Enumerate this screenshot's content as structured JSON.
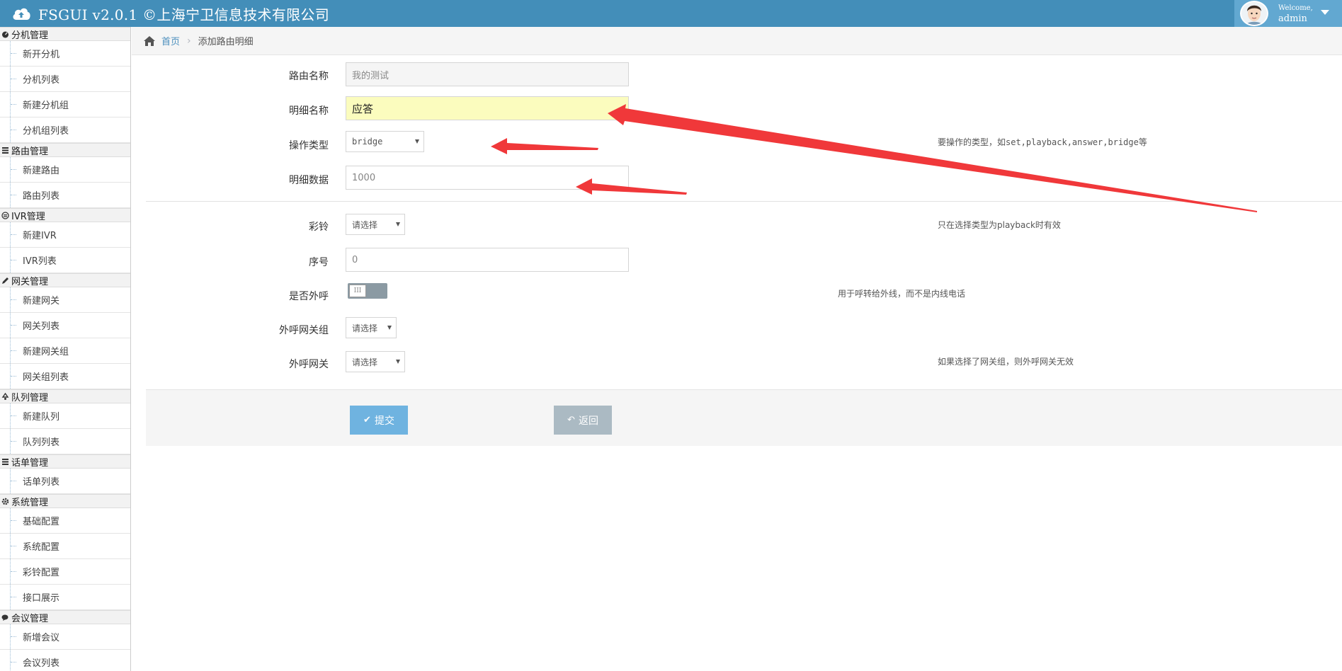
{
  "app": {
    "title": "FSGUI v2.0.1 ©上海宁卫信息技术有限公司",
    "welcome": "Welcome,",
    "username": "admin",
    "navbar_color": "#438eb9"
  },
  "sidebar": {
    "groups": [
      {
        "title": "分机管理",
        "icon": "dashboard-icon",
        "items": [
          "新开分机",
          "分机列表",
          "新建分机组",
          "分机组列表"
        ]
      },
      {
        "title": "路由管理",
        "icon": "list-icon",
        "items": [
          "新建路由",
          "路由列表"
        ]
      },
      {
        "title": "IVR管理",
        "icon": "ivr-icon",
        "items": [
          "新建IVR",
          "IVR列表"
        ]
      },
      {
        "title": "网关管理",
        "icon": "pencil-icon",
        "items": [
          "新建网关",
          "网关列表",
          "新建网关组",
          "网关组列表"
        ]
      },
      {
        "title": "队列管理",
        "icon": "recycle-icon",
        "items": [
          "新建队列",
          "队列列表"
        ]
      },
      {
        "title": "话单管理",
        "icon": "list-icon",
        "items": [
          "话单列表"
        ]
      },
      {
        "title": "系统管理",
        "icon": "gear-icon",
        "items": [
          "基础配置",
          "系统配置",
          "彩铃配置",
          "接口展示"
        ]
      },
      {
        "title": "会议管理",
        "icon": "chat-icon",
        "items": [
          "新增会议",
          "会议列表"
        ]
      }
    ]
  },
  "breadcrumb": {
    "home": "首页",
    "current": "添加路由明细"
  },
  "form": {
    "route_name": {
      "label": "路由名称",
      "value": "我的测试"
    },
    "detail_name": {
      "label": "明细名称",
      "value": "应答"
    },
    "op_type": {
      "label": "操作类型",
      "value": "bridge",
      "help": "要操作的类型，如set,playback,answer,bridge等"
    },
    "detail_data": {
      "label": "明细数据",
      "value": "1000"
    },
    "ringtone": {
      "label": "彩铃",
      "value": "请选择",
      "help": "只在选择类型为playback时有效"
    },
    "seq": {
      "label": "序号",
      "value": "0"
    },
    "outbound": {
      "label": "是否外呼",
      "toggle_text": "III",
      "help": "用于呼转给外线，而不是内线电话"
    },
    "gw_group": {
      "label": "外呼网关组",
      "value": "请选择"
    },
    "gateway": {
      "label": "外呼网关",
      "value": "请选择",
      "help": "如果选择了网关组，则外呼网关无效"
    }
  },
  "buttons": {
    "submit": "提交",
    "back": "返回"
  },
  "annotation_color": "#f0383a"
}
